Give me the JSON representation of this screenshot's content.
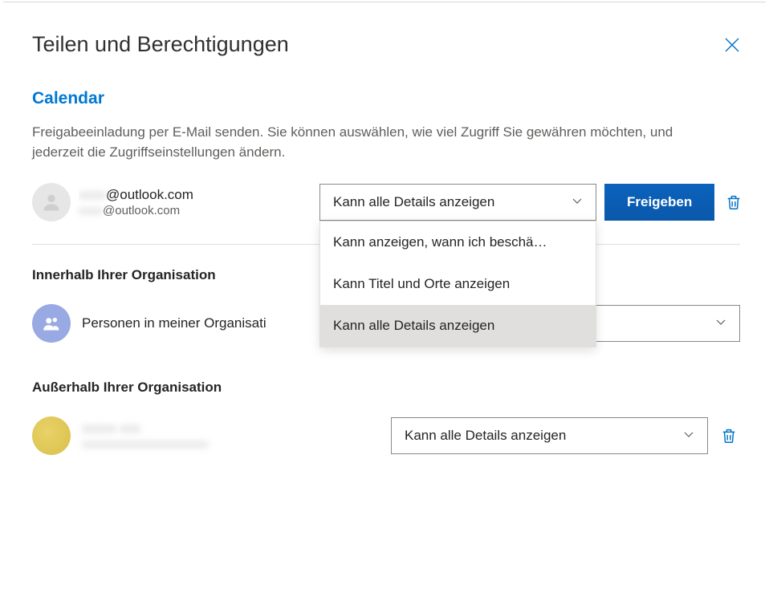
{
  "dialog": {
    "title": "Teilen und Berechtigungen",
    "calendar_label": "Calendar",
    "description": "Freigabeeinladung per E-Mail senden. Sie können auswählen, wie viel Zugriff Sie gewähren möchten, und jederzeit die Zugriffseinstellungen ändern."
  },
  "invite": {
    "email_primary": "@outlook.com",
    "email_secondary": "@outlook.com",
    "permission_selected": "Kann alle Details anzeigen",
    "permission_options": {
      "0": "Kann anzeigen, wann ich beschä…",
      "1": "Kann Titel und Orte anzeigen",
      "2": "Kann alle Details anzeigen"
    },
    "share_button": "Freigeben"
  },
  "sections": {
    "inside_org_heading": "Innerhalb Ihrer Organisation",
    "inside_org_label": "Personen in meiner Organisati",
    "outside_org_heading": "Außerhalb Ihrer Organisation"
  },
  "external": {
    "permission_selected": "Kann alle Details anzeigen"
  }
}
